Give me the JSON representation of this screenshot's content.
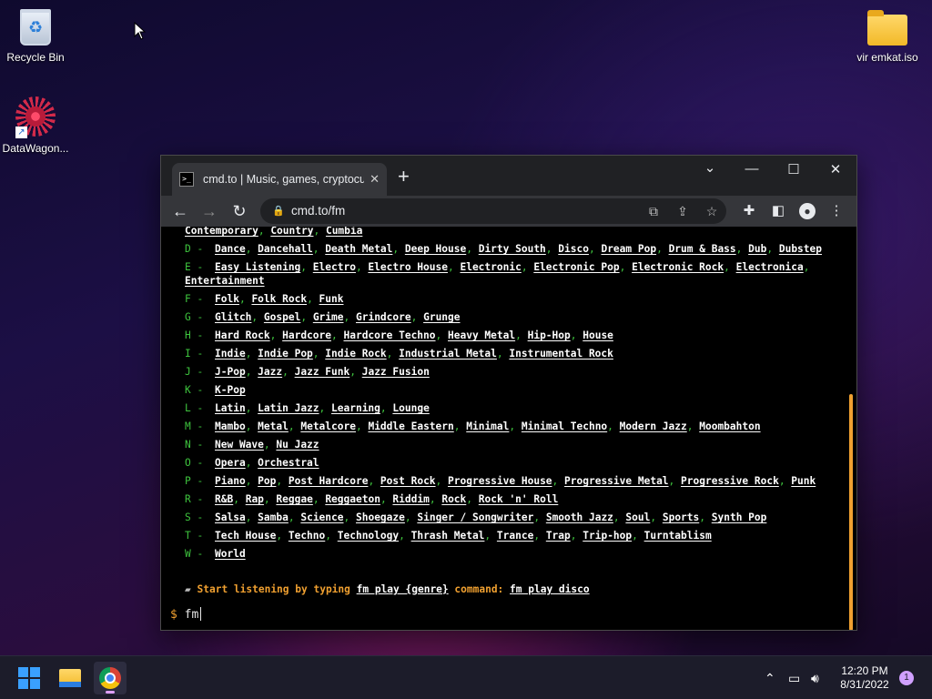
{
  "desktop": {
    "icons": [
      {
        "label": "Recycle Bin",
        "icon": "recycle-bin-icon"
      },
      {
        "label": "DataWagon...",
        "icon": "datawagon-icon"
      },
      {
        "label": "vir emkat.iso",
        "icon": "folder-icon"
      }
    ]
  },
  "browser": {
    "tab_title": "cmd.to | Music, games, cryptocur",
    "url": "cmd.to/fm",
    "favicon_text": ">_"
  },
  "terminal": {
    "partial_top_row": [
      "Contemporary",
      "Country",
      "Cumbia"
    ],
    "genre_rows": [
      {
        "letter": "D -",
        "items": [
          "Dance",
          "Dancehall",
          "Death Metal",
          "Deep House",
          "Dirty South",
          "Disco",
          "Dream Pop",
          "Drum & Bass",
          "Dub",
          "Dubstep"
        ]
      },
      {
        "letter": "E -",
        "items": [
          "Easy Listening",
          "Electro",
          "Electro House",
          "Electronic",
          "Electronic Pop",
          "Electronic Rock",
          "Electronica"
        ],
        "wrap": [
          "Entertainment"
        ]
      },
      {
        "letter": "F -",
        "items": [
          "Folk",
          "Folk Rock",
          "Funk"
        ]
      },
      {
        "letter": "G -",
        "items": [
          "Glitch",
          "Gospel",
          "Grime",
          "Grindcore",
          "Grunge"
        ]
      },
      {
        "letter": "H -",
        "items": [
          "Hard Rock",
          "Hardcore",
          "Hardcore Techno",
          "Heavy Metal",
          "Hip-Hop",
          "House"
        ]
      },
      {
        "letter": "I -",
        "items": [
          "Indie",
          "Indie Pop",
          "Indie Rock",
          "Industrial Metal",
          "Instrumental Rock"
        ]
      },
      {
        "letter": "J -",
        "items": [
          "J-Pop",
          "Jazz",
          "Jazz Funk",
          "Jazz Fusion"
        ]
      },
      {
        "letter": "K -",
        "items": [
          "K-Pop"
        ]
      },
      {
        "letter": "L -",
        "items": [
          "Latin",
          "Latin Jazz",
          "Learning",
          "Lounge"
        ]
      },
      {
        "letter": "M -",
        "items": [
          "Mambo",
          "Metal",
          "Metalcore",
          "Middle Eastern",
          "Minimal",
          "Minimal Techno",
          "Modern Jazz",
          "Moombahton"
        ]
      },
      {
        "letter": "N -",
        "items": [
          "New Wave",
          "Nu Jazz"
        ]
      },
      {
        "letter": "O -",
        "items": [
          "Opera",
          "Orchestral"
        ]
      },
      {
        "letter": "P -",
        "items": [
          "Piano",
          "Pop",
          "Post Hardcore",
          "Post Rock",
          "Progressive House",
          "Progressive Metal",
          "Progressive Rock",
          "Punk"
        ]
      },
      {
        "letter": "R -",
        "items": [
          "R&B",
          "Rap",
          "Reggae",
          "Reggaeton",
          "Riddim",
          "Rock",
          "Rock 'n' Roll"
        ]
      },
      {
        "letter": "S -",
        "items": [
          "Salsa",
          "Samba",
          "Science",
          "Shoegaze",
          "Singer / Songwriter",
          "Smooth Jazz",
          "Soul",
          "Sports",
          "Synth Pop"
        ]
      },
      {
        "letter": "T -",
        "items": [
          "Tech House",
          "Techno",
          "Technology",
          "Thrash Metal",
          "Trance",
          "Trap",
          "Trip-hop",
          "Turntablism"
        ]
      },
      {
        "letter": "W -",
        "items": [
          "World"
        ]
      }
    ],
    "hint": {
      "prefix": "Start listening by typing ",
      "command_template": "fm play {genre}",
      "middle": " command: ",
      "example": "fm play disco"
    },
    "prompt_symbol": "$",
    "prompt_input": "fm"
  },
  "taskbar": {
    "time": "12:20 PM",
    "date": "8/31/2022",
    "notification_count": "1"
  },
  "colors": {
    "terminal_letter": "#3ec43e",
    "terminal_hint": "#f0a030",
    "accent": "#3aa0ff"
  }
}
